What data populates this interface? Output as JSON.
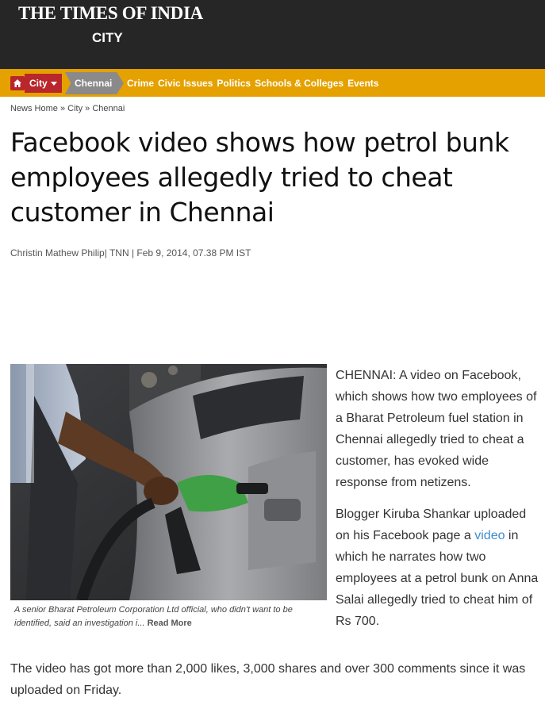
{
  "header": {
    "brand": "THE TIMES OF INDIA",
    "section": "CITY"
  },
  "nav": {
    "home_icon": "home-icon",
    "city_label": "City",
    "current_label": "Chennai",
    "links": [
      "Crime",
      "Civic Issues",
      "Politics",
      "Schools & Colleges",
      "Events"
    ]
  },
  "breadcrumb": {
    "items": [
      "News Home",
      "City",
      "Chennai"
    ],
    "separator": "»"
  },
  "article": {
    "title": "Facebook video shows how petrol bunk employees allegedly tried to cheat customer in Chennai",
    "byline": "Christin Mathew Philip| TNN | Feb 9, 2014, 07.38 PM IST",
    "caption": "A senior Bharat Petroleum Corporation Ltd official, who didn't want to be identified, said an investigation i...",
    "read_more": "Read More",
    "para1": "CHENNAI: A video on Facebook, which shows how two employees of a Bharat Petroleum fuel station in Chennai allegedly tried to cheat a customer, has evoked wide response from netizens.",
    "para2_before": "Blogger Kiruba Shankar uploaded on his Facebook page a ",
    "para2_link": "video",
    "para2_after": " in which he narrates how two employees at a petrol bunk on Anna Salai allegedly tried to cheat him of Rs 700.",
    "para3": "The video has got more than 2,000 likes, 3,000 shares and over 300 comments since it was uploaded on Friday."
  },
  "colors": {
    "masthead": "#262626",
    "navbar": "#e5a100",
    "city_tab": "#b8272b",
    "current_tab": "#8a8a8a",
    "link": "#3f8bd1"
  }
}
